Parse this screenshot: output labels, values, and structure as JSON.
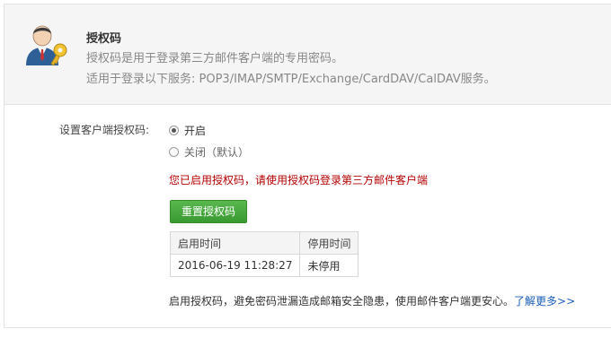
{
  "header": {
    "title": "授权码",
    "line1": "授权码是用于登录第三方邮件客户端的专用密码。",
    "line2": "适用于登录以下服务: POP3/IMAP/SMTP/Exchange/CardDAV/CalDAV服务。"
  },
  "settings": {
    "label": "设置客户端授权码:",
    "options": [
      {
        "label": "开启",
        "checked": true
      },
      {
        "label": "关闭（默认）",
        "checked": false
      }
    ],
    "notice": "您已启用授权码，请使用授权码登录第三方邮件客户端",
    "reset_button": "重置授权码"
  },
  "table": {
    "headers": [
      "启用时间",
      "停用时间"
    ],
    "rows": [
      [
        "2016-06-19 11:28:27",
        "未停用"
      ]
    ]
  },
  "footer": {
    "text": "启用授权码，避免密码泄漏造成邮箱安全隐患，使用邮件客户端更安心。",
    "link": "了解更多",
    "link_arrow": ">>"
  },
  "colors": {
    "notice": "#b40000",
    "button": "#3f9f36",
    "link": "#1a5cb8"
  }
}
